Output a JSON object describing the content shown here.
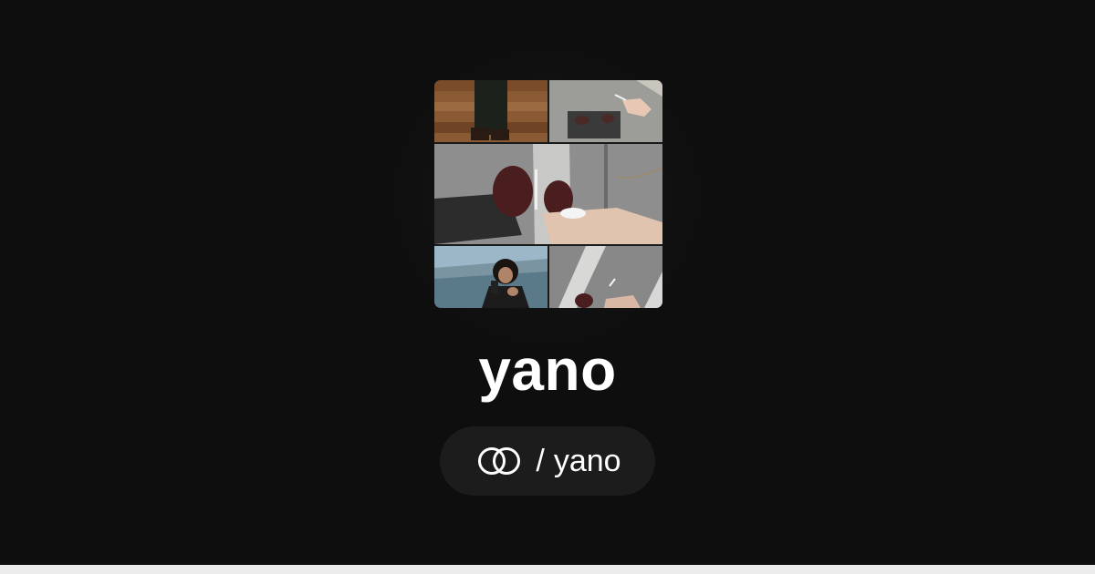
{
  "profile": {
    "display_name": "yano",
    "handle_separator": "/",
    "handle": "yano",
    "logo_icon": "linked-rings-icon",
    "avatar_icon": "photo-collage-avatar"
  },
  "colors": {
    "background": "#0e0e0e",
    "pill_background": "#1c1c1c",
    "text": "#ffffff"
  }
}
